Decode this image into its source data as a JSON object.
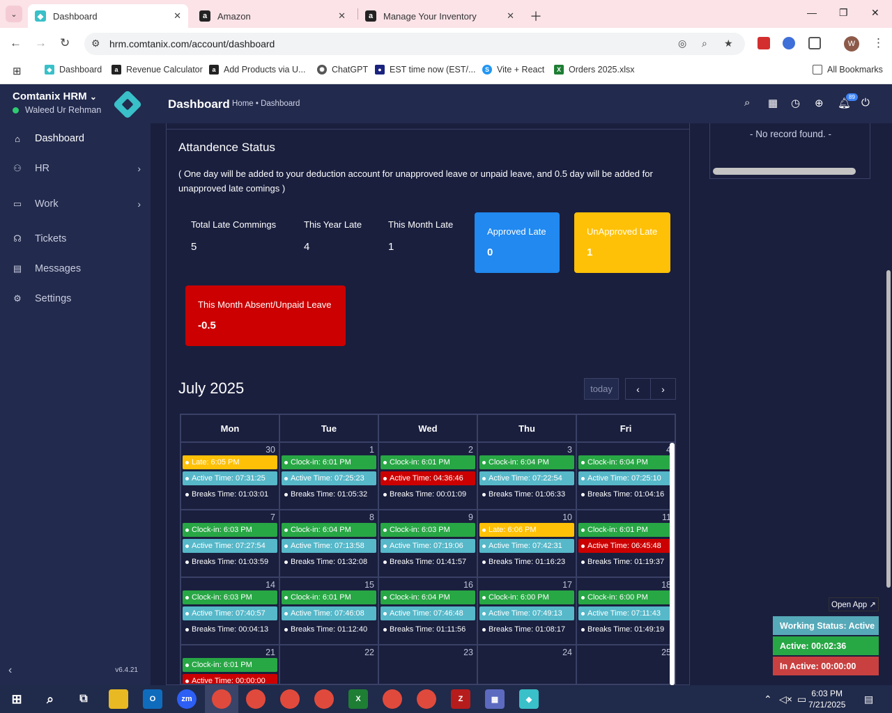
{
  "browser": {
    "tabs": [
      {
        "title": "Dashboard",
        "icon": "comtanix-logo-icon",
        "active": true
      },
      {
        "title": "Amazon",
        "icon": "amazon-icon",
        "active": false
      },
      {
        "title": "Manage Your Inventory",
        "icon": "amazon-icon",
        "active": false
      }
    ],
    "url": "hrm.comtanix.com/account/dashboard",
    "bookmarks": [
      "Dashboard",
      "Revenue Calculator",
      "Add Products via U...",
      "ChatGPT",
      "EST time now (EST/...",
      "Vite + React",
      "Orders 2025.xlsx"
    ],
    "all_bookmarks": "All Bookmarks",
    "profile_initial": "W"
  },
  "sidebar": {
    "org": "Comtanix HRM",
    "user": "Waleed Ur Rehman",
    "items": [
      {
        "label": "Dashboard",
        "icon": "home-icon"
      },
      {
        "label": "HR",
        "icon": "users-icon"
      },
      {
        "label": "Work",
        "icon": "briefcase-icon"
      },
      {
        "label": "Tickets",
        "icon": "headset-icon"
      },
      {
        "label": "Messages",
        "icon": "message-icon"
      },
      {
        "label": "Settings",
        "icon": "gear-icon"
      }
    ],
    "version": "v6.4.21"
  },
  "header": {
    "title": "Dashboard",
    "breadcrumb": "Home • Dashboard",
    "notifications": "89"
  },
  "attendance": {
    "title": "Attandence Status",
    "note": "( One day will be added to your deduction account for unapproved leave or unpaid leave, and 0.5 day will be added for unapproved late comings )",
    "stats": [
      {
        "label": "Total Late Commings",
        "value": "5"
      },
      {
        "label": "This Year Late",
        "value": "4"
      },
      {
        "label": "This Month Late",
        "value": "1"
      }
    ],
    "approved": {
      "label": "Approved Late",
      "value": "0"
    },
    "unapproved": {
      "label": "UnApproved Late",
      "value": "1"
    },
    "absent": {
      "label": "This Month Absent/Unpaid Leave",
      "value": "-0.5"
    }
  },
  "calendar": {
    "title": "July 2025",
    "today": "today",
    "days": [
      "Mon",
      "Tue",
      "Wed",
      "Thu",
      "Fri"
    ],
    "weeks": [
      {
        "dates": [
          "30",
          "1",
          "2",
          "3",
          "4"
        ],
        "events": [
          [
            [
              "yellow",
              "Late: 6:05 PM"
            ],
            [
              "teal",
              "Active Time: 07:31:25"
            ],
            [
              "dark",
              "Breaks Time: 01:03:01"
            ]
          ],
          [
            [
              "green",
              "Clock-in: 6:01 PM"
            ],
            [
              "teal",
              "Active Time: 07:25:23"
            ],
            [
              "dark",
              "Breaks Time: 01:05:32"
            ]
          ],
          [
            [
              "green",
              "Clock-in: 6:01 PM"
            ],
            [
              "red",
              "Active Time: 04:36:46"
            ],
            [
              "dark",
              "Breaks Time: 00:01:09"
            ]
          ],
          [
            [
              "green",
              "Clock-in: 6:04 PM"
            ],
            [
              "teal",
              "Active Time: 07:22:54"
            ],
            [
              "dark",
              "Breaks Time: 01:06:33"
            ]
          ],
          [
            [
              "green",
              "Clock-in: 6:04 PM"
            ],
            [
              "teal",
              "Active Time: 07:25:10"
            ],
            [
              "dark",
              "Breaks Time: 01:04:16"
            ]
          ]
        ]
      },
      {
        "dates": [
          "7",
          "8",
          "9",
          "10",
          "11"
        ],
        "events": [
          [
            [
              "green",
              "Clock-in: 6:03 PM"
            ],
            [
              "teal",
              "Active Time: 07:27:54"
            ],
            [
              "dark",
              "Breaks Time: 01:03:59"
            ]
          ],
          [
            [
              "green",
              "Clock-in: 6:04 PM"
            ],
            [
              "teal",
              "Active Time: 07:13:58"
            ],
            [
              "dark",
              "Breaks Time: 01:32:08"
            ]
          ],
          [
            [
              "green",
              "Clock-in: 6:03 PM"
            ],
            [
              "teal",
              "Active Time: 07:19:06"
            ],
            [
              "dark",
              "Breaks Time: 01:41:57"
            ]
          ],
          [
            [
              "yellow",
              "Late: 6:06 PM"
            ],
            [
              "teal",
              "Active Time: 07:42:31"
            ],
            [
              "dark",
              "Breaks Time: 01:16:23"
            ]
          ],
          [
            [
              "green",
              "Clock-in: 6:01 PM"
            ],
            [
              "red",
              "Active Time: 06:45:48"
            ],
            [
              "dark",
              "Breaks Time: 01:19:37"
            ]
          ]
        ]
      },
      {
        "dates": [
          "14",
          "15",
          "16",
          "17",
          "18"
        ],
        "events": [
          [
            [
              "green",
              "Clock-in: 6:03 PM"
            ],
            [
              "teal",
              "Active Time: 07:40:57"
            ],
            [
              "dark",
              "Breaks Time: 00:04:13"
            ]
          ],
          [
            [
              "green",
              "Clock-in: 6:01 PM"
            ],
            [
              "teal",
              "Active Time: 07:46:08"
            ],
            [
              "dark",
              "Breaks Time: 01:12:40"
            ]
          ],
          [
            [
              "green",
              "Clock-in: 6:04 PM"
            ],
            [
              "teal",
              "Active Time: 07:46:48"
            ],
            [
              "dark",
              "Breaks Time: 01:11:56"
            ]
          ],
          [
            [
              "green",
              "Clock-in: 6:00 PM"
            ],
            [
              "teal",
              "Active Time: 07:49:13"
            ],
            [
              "dark",
              "Breaks Time: 01:08:17"
            ]
          ],
          [
            [
              "green",
              "Clock-in: 6:00 PM"
            ],
            [
              "teal",
              "Active Time: 07:11:43"
            ],
            [
              "dark",
              "Breaks Time: 01:49:19"
            ]
          ]
        ]
      },
      {
        "dates": [
          "21",
          "22",
          "23",
          "24",
          "25"
        ],
        "events": [
          [
            [
              "green",
              "Clock-in: 6:01 PM"
            ],
            [
              "red",
              "Active Time: 00:00:00"
            ]
          ],
          [],
          [],
          [],
          []
        ]
      }
    ]
  },
  "right_panel": {
    "no_record": "- No record found. -"
  },
  "widget": {
    "open_app": "Open App ↗",
    "working_status": "Working Status: Active",
    "active": "Active: 00:02:36",
    "inactive": "In Active: 00:00:00"
  },
  "taskbar": {
    "time": "6:03 PM",
    "date": "7/21/2025"
  },
  "colors": {
    "green": "#28a745",
    "yellow": "#ffc107",
    "teal": "#56b8c9",
    "red": "#cc0000",
    "blue": "#2189f0",
    "sidebar": "#222a4d",
    "bg": "#1a1f3e"
  }
}
